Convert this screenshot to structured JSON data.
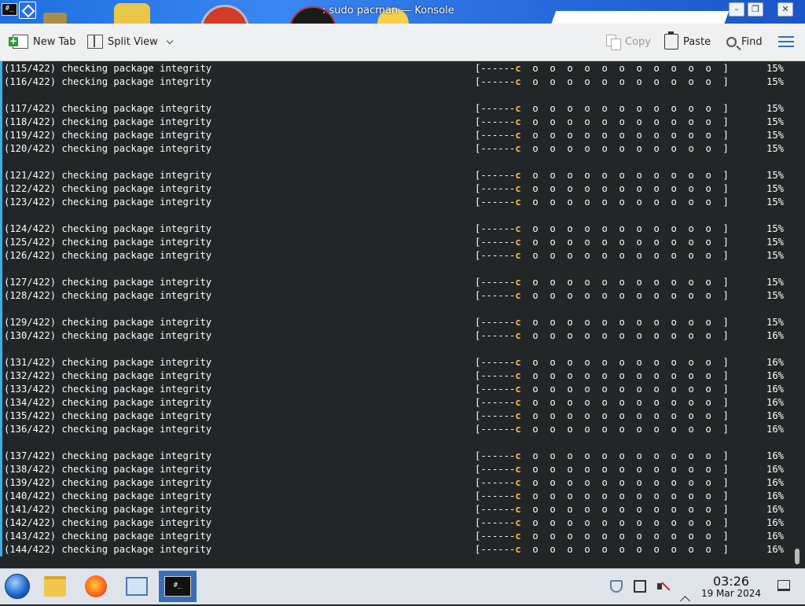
{
  "window": {
    "title": ": sudo pacman — Konsole"
  },
  "toolbar": {
    "new_tab": "New Tab",
    "split_view": "Split View",
    "copy": "Copy",
    "paste": "Paste",
    "find": "Find"
  },
  "terminal": {
    "task_label": "checking package integrity",
    "total": 422,
    "bar_prefix": "[------",
    "pacman_char": "c",
    "bar_suffix": "  o  o  o  o  o  o  o  o  o  o  o  ]",
    "lines": [
      {
        "n": "115",
        "pct": "15%"
      },
      {
        "n": "116",
        "pct": "15%"
      },
      null,
      {
        "n": "117",
        "pct": "15%"
      },
      {
        "n": "118",
        "pct": "15%"
      },
      {
        "n": "119",
        "pct": "15%"
      },
      {
        "n": "120",
        "pct": "15%"
      },
      null,
      {
        "n": "121",
        "pct": "15%"
      },
      {
        "n": "122",
        "pct": "15%"
      },
      {
        "n": "123",
        "pct": "15%"
      },
      null,
      {
        "n": "124",
        "pct": "15%"
      },
      {
        "n": "125",
        "pct": "15%"
      },
      {
        "n": "126",
        "pct": "15%"
      },
      null,
      {
        "n": "127",
        "pct": "15%"
      },
      {
        "n": "128",
        "pct": "15%"
      },
      null,
      {
        "n": "129",
        "pct": "15%"
      },
      {
        "n": "130",
        "pct": "16%"
      },
      null,
      {
        "n": "131",
        "pct": "16%"
      },
      {
        "n": "132",
        "pct": "16%"
      },
      {
        "n": "133",
        "pct": "16%"
      },
      {
        "n": "134",
        "pct": "16%"
      },
      {
        "n": "135",
        "pct": "16%"
      },
      {
        "n": "136",
        "pct": "16%"
      },
      null,
      {
        "n": "137",
        "pct": "16%"
      },
      {
        "n": "138",
        "pct": "16%"
      },
      {
        "n": "139",
        "pct": "16%"
      },
      {
        "n": "140",
        "pct": "16%"
      },
      {
        "n": "141",
        "pct": "16%"
      },
      {
        "n": "142",
        "pct": "16%"
      },
      {
        "n": "143",
        "pct": "16%"
      },
      {
        "n": "144",
        "pct": "16%"
      }
    ]
  },
  "taskbar": {
    "clock_time": "03:26",
    "clock_date": "19 Mar 2024",
    "tasks": [
      "start-menu-icon",
      "file-manager-icon",
      "firefox-icon",
      "system-settings-icon",
      "konsole-icon"
    ]
  },
  "colors": {
    "terminal_bg": "#232627",
    "pacman": "#fdbc4b",
    "accent": "#3daee9"
  }
}
